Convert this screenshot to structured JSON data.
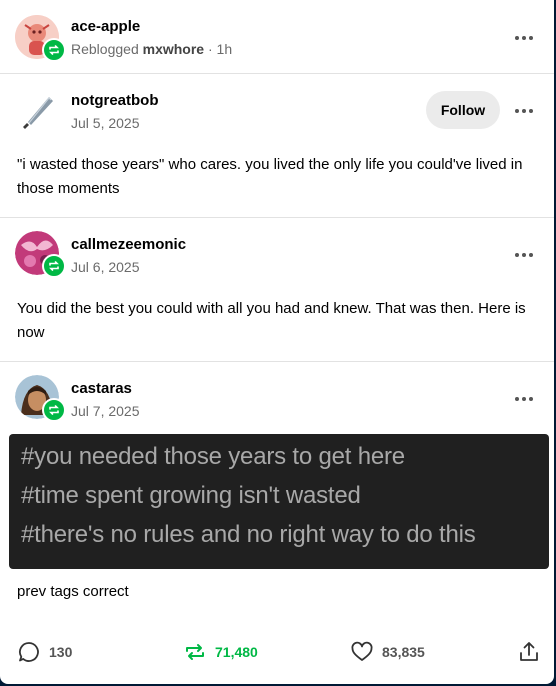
{
  "header": {
    "username": "ace-apple",
    "reblogged_prefix": "Reblogged",
    "reblogged_from": "mxwhore",
    "time": "· 1h"
  },
  "posts": [
    {
      "username": "notgreatbob",
      "date": "Jul 5, 2025",
      "follow_label": "Follow",
      "text": "\"i wasted those years\" who cares. you lived the only life you could've lived in those moments"
    },
    {
      "username": "callmezeemonic",
      "date": "Jul 6, 2025",
      "text": "You did the best you could with all you had and knew. That was then. Here is now"
    },
    {
      "username": "castaras",
      "date": "Jul 7, 2025",
      "tags": [
        "#you needed those years to get here",
        "#time spent growing isn't wasted",
        "#there's no rules and no right way to do this"
      ],
      "text": "prev tags correct"
    }
  ],
  "footer": {
    "comments": "130",
    "reblogs": "71,480",
    "likes": "83,835"
  },
  "colors": {
    "reblog_green": "#00b845",
    "page_navy": "#001935"
  },
  "icons": [
    "comment-icon",
    "reblog-icon",
    "heart-icon",
    "share-icon",
    "more-icon",
    "knife-icon"
  ]
}
